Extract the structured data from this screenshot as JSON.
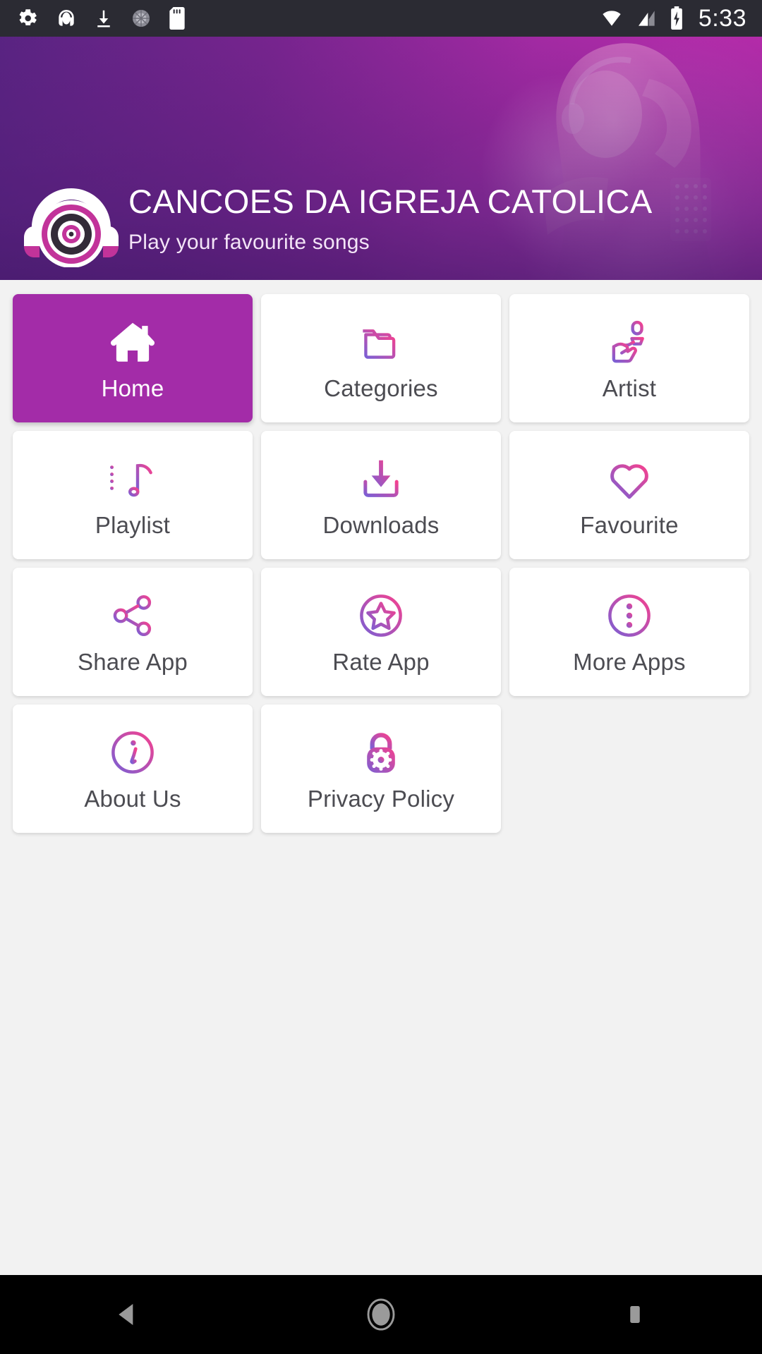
{
  "status_bar": {
    "icons": [
      "settings-gear-icon",
      "headphones-icon",
      "download-icon",
      "sync-spinner-icon",
      "sd-card-icon"
    ],
    "right_icons": [
      "wifi-icon",
      "cell-signal-icon",
      "battery-charging-icon"
    ],
    "clock": "5:33"
  },
  "header": {
    "logo": "headphones-vinyl-logo",
    "title": "CANCOES DA IGREJA CATOLICA",
    "subtitle": "Play your favourite songs",
    "gradient_from": "#5a2483",
    "gradient_to": "#c32db0"
  },
  "theme": {
    "active_card": "#a32ca8",
    "icon_gradient_from": "#7b5fd4",
    "icon_gradient_to": "#f5418f",
    "label_color": "#4c4c52",
    "page_background": "#f2f2f2"
  },
  "grid": {
    "items": [
      {
        "label": "Home",
        "icon": "home-icon",
        "active": true
      },
      {
        "label": "Categories",
        "icon": "folder-icon",
        "active": false
      },
      {
        "label": "Artist",
        "icon": "microphone-hand-icon",
        "active": false
      },
      {
        "label": "Playlist",
        "icon": "playlist-note-icon",
        "active": false
      },
      {
        "label": "Downloads",
        "icon": "download-tray-icon",
        "active": false
      },
      {
        "label": "Favourite",
        "icon": "heart-icon",
        "active": false
      },
      {
        "label": "Share App",
        "icon": "share-nodes-icon",
        "active": false
      },
      {
        "label": "Rate App",
        "icon": "star-circle-icon",
        "active": false
      },
      {
        "label": "More Apps",
        "icon": "dots-vertical-circle-icon",
        "active": false
      },
      {
        "label": "About Us",
        "icon": "info-circle-icon",
        "active": false
      },
      {
        "label": "Privacy Policy",
        "icon": "lock-gear-icon",
        "active": false
      }
    ]
  },
  "navigation_bar": {
    "back": "back-triangle-icon",
    "home": "home-circle-icon",
    "recents": "recents-square-icon"
  }
}
